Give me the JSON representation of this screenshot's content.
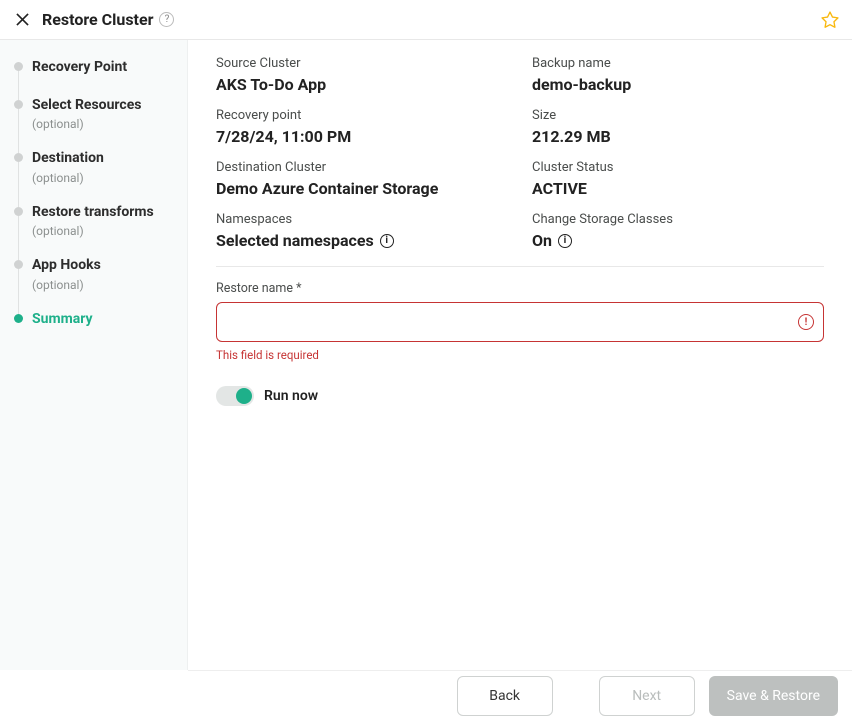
{
  "header": {
    "title": "Restore Cluster",
    "help_glyph": "?"
  },
  "sidebar": {
    "optional_text": "(optional)",
    "steps": [
      {
        "label": "Recovery Point",
        "optional": false,
        "active": false
      },
      {
        "label": "Select Resources",
        "optional": true,
        "active": false
      },
      {
        "label": "Destination",
        "optional": true,
        "active": false
      },
      {
        "label": "Restore transforms",
        "optional": true,
        "active": false
      },
      {
        "label": "App Hooks",
        "optional": true,
        "active": false
      },
      {
        "label": "Summary",
        "optional": false,
        "active": true
      }
    ]
  },
  "summary": {
    "fields": {
      "source_cluster": {
        "label": "Source Cluster",
        "value": "AKS To-Do App"
      },
      "backup_name": {
        "label": "Backup name",
        "value": "demo-backup"
      },
      "recovery_point": {
        "label": "Recovery point",
        "value": "7/28/24, 11:00 PM"
      },
      "size": {
        "label": "Size",
        "value": "212.29 MB"
      },
      "dest_cluster": {
        "label": "Destination Cluster",
        "value": "Demo Azure Container Storage"
      },
      "cluster_status": {
        "label": "Cluster Status",
        "value": "ACTIVE"
      },
      "namespaces": {
        "label": "Namespaces",
        "value": "Selected namespaces",
        "info": true
      },
      "storage_classes": {
        "label": "Change Storage Classes",
        "value": "On",
        "info": true
      }
    },
    "info_glyph": "i"
  },
  "restore_name": {
    "label": "Restore name *",
    "value": "",
    "placeholder": "",
    "error": "This field is required",
    "error_glyph": "!"
  },
  "run_now": {
    "label": "Run now",
    "on": true
  },
  "footer": {
    "back": "Back",
    "next": "Next",
    "save": "Save & Restore"
  }
}
